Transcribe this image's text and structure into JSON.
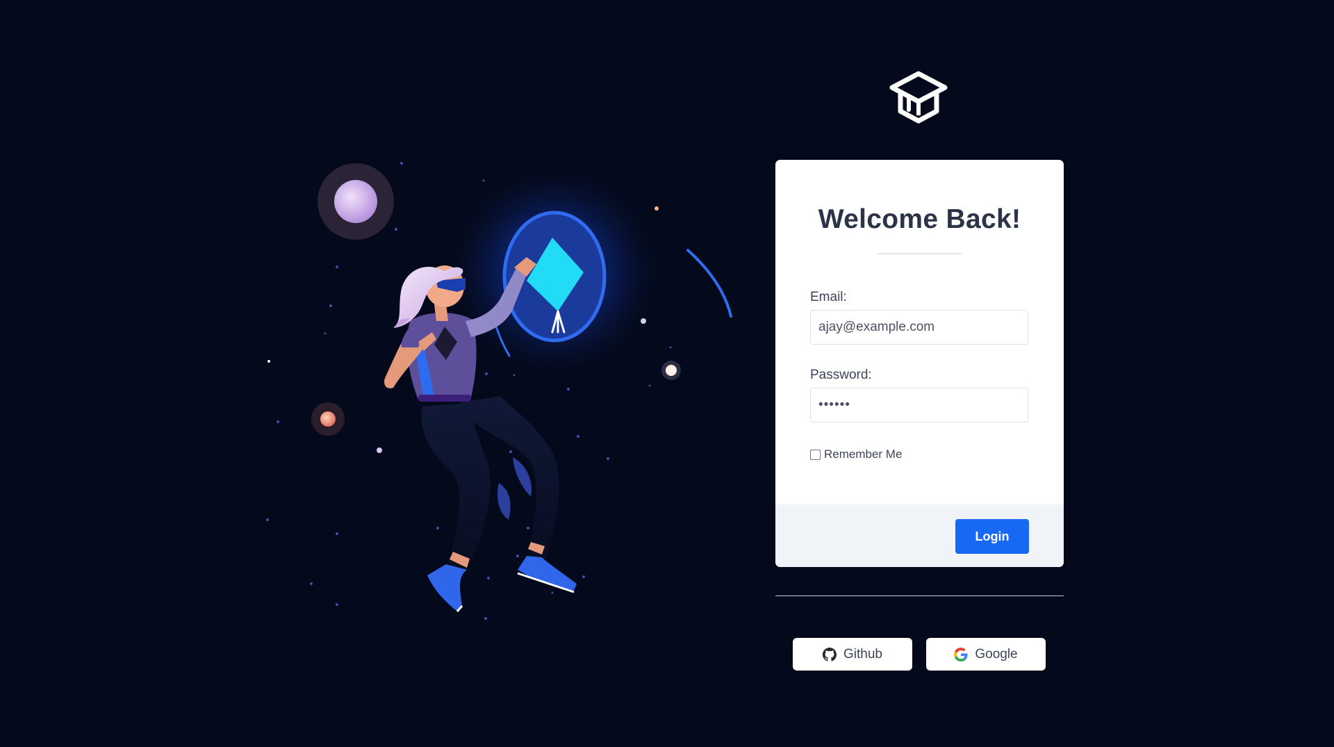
{
  "login_card": {
    "title": "Welcome Back!",
    "email_label": "Email:",
    "email_value": "ajay@example.com",
    "password_label": "Password:",
    "password_value": "••••••",
    "remember_label": "Remember Me",
    "remember_checked": false,
    "login_label": "Login"
  },
  "social": {
    "github_label": "Github",
    "google_label": "Google"
  },
  "icons": {
    "logo": "graduation-cap-icon",
    "github": "github-icon",
    "google": "google-icon"
  },
  "colors": {
    "background": "#040a1c",
    "primary": "#1768f2",
    "card": "#ffffff",
    "card_footer": "#f0f3f7",
    "title": "#2b3448"
  }
}
